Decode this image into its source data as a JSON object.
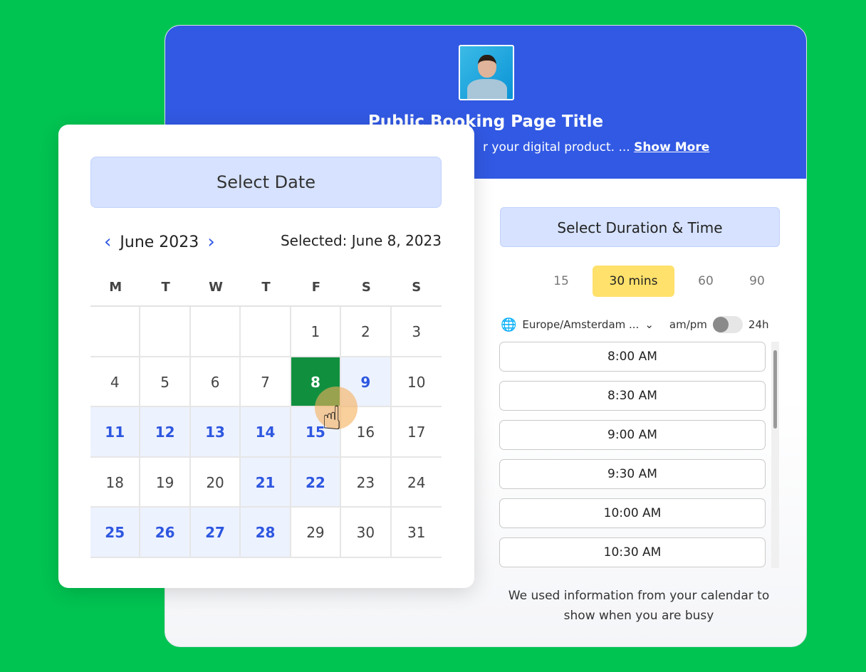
{
  "booking": {
    "title": "Public Booking Page Title",
    "description": "r your digital product. ...",
    "show_more": "Show More"
  },
  "duration": {
    "title": "Select Duration & Time",
    "options": [
      "15",
      "30 mins",
      "60",
      "90"
    ],
    "selected": "30 mins",
    "timezone": "Europe/Amsterdam ...",
    "format_left": "am/pm",
    "format_right": "24h",
    "toggle_24h": false,
    "slots": [
      "8:00 AM",
      "8:30 AM",
      "9:00 AM",
      "9:30 AM",
      "10:00 AM",
      "10:30 AM"
    ],
    "note": "We used information from your calendar to show when you are busy"
  },
  "calendar": {
    "title": "Select Date",
    "month": "June 2023",
    "selected": "Selected:  June 8, 2023",
    "weekdays": [
      "M",
      "T",
      "W",
      "T",
      "F",
      "S",
      "S"
    ],
    "days": [
      "",
      "",
      "",
      "",
      "1",
      "2",
      "3",
      "4",
      "5",
      "6",
      "7",
      "8",
      "9",
      "10",
      "11",
      "12",
      "13",
      "14",
      "15",
      "16",
      "17",
      "18",
      "19",
      "20",
      "21",
      "22",
      "23",
      "24",
      "25",
      "26",
      "27",
      "28",
      "29",
      "30",
      "31"
    ],
    "available": [
      "9",
      "11",
      "12",
      "13",
      "14",
      "15",
      "21",
      "22",
      "25",
      "26",
      "27",
      "28"
    ],
    "selected_day": "8"
  },
  "colors": {
    "background": "#00c452",
    "header": "#3159e3",
    "selected": "#10903f",
    "accent": "#ffe16b"
  }
}
